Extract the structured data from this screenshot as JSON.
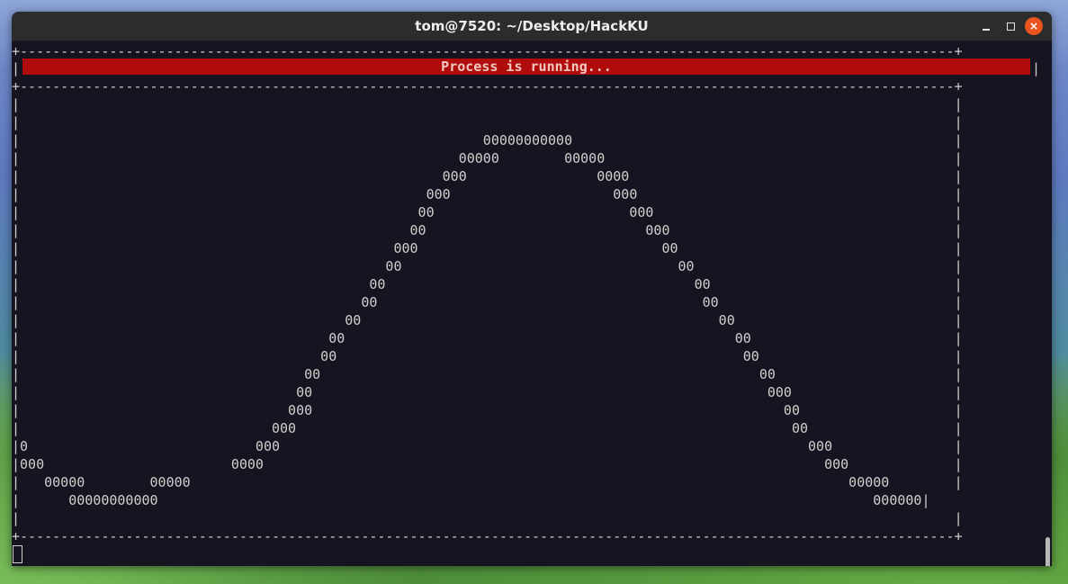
{
  "window": {
    "title": "tom@7520: ~/Desktop/HackKU",
    "buttons": {
      "minimize": "minimize",
      "maximize": "maximize",
      "close": "×"
    }
  },
  "terminal": {
    "border_top": "+-------------------------------------------------------------------------------------------------------------------+",
    "banner_text": "Process is running...",
    "border_mid": "+-------------------------------------------------------------------------------------------------------------------+",
    "border_bottom": "+-------------------------------------------------------------------------------------------------------------------+",
    "lines": [
      "|                                                                                                                   |",
      "|                                                                                                                   |",
      "|                                                         00000000000                                               |",
      "|                                                      00000        00000                                           |",
      "|                                                    000                0000                                        |",
      "|                                                  000                    000                                       |",
      "|                                                 00                        000                                     |",
      "|                                                00                           000                                   |",
      "|                                              000                              00                                  |",
      "|                                             00                                  00                                |",
      "|                                           00                                      00                              |",
      "|                                          00                                        00                             |",
      "|                                        00                                            00                           |",
      "|                                      00                                                00                         |",
      "|                                     00                                                  00                        |",
      "|                                   00                                                      00                      |",
      "|                                  00                                                        000                    |",
      "|                                 000                                                          00                   |",
      "|                               000                                                             00                  |",
      "|0                            000                                                                 000               |",
      "|000                       0000                                                                     000             |",
      "|   00000        00000                                                                                 00000        |",
      "|      00000000000                                                                                        000000|",
      "|                                                                                                                   |"
    ]
  }
}
